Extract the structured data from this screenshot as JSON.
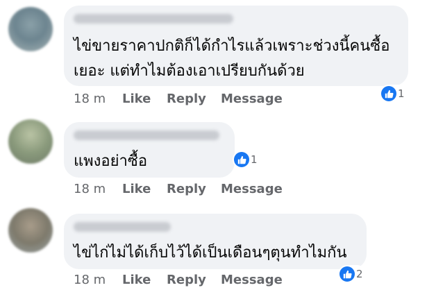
{
  "comments": [
    {
      "text_lines": [
        "ไข่ขายราคาปกติก็ได้กำไรแล้วเพราะช่วงนี้คนซื้อ",
        "เยอะ แต่ทำไมต้องเอาเปรียบกันด้วย"
      ],
      "time": "18 m",
      "like_label": "Like",
      "reply_label": "Reply",
      "message_label": "Message",
      "reaction_count": "1"
    },
    {
      "text_lines": [
        "แพงอย่าซื้อ"
      ],
      "time": "18 m",
      "like_label": "Like",
      "reply_label": "Reply",
      "message_label": "Message",
      "reaction_count": "1"
    },
    {
      "text_lines": [
        "ไข่ไก่ไม่ได้เก็บไว้ได้เป็นเดือนๆตุนทำไมกัน"
      ],
      "time": "18 m",
      "like_label": "Like",
      "reply_label": "Reply",
      "message_label": "Message",
      "reaction_count": "2"
    }
  ],
  "colors": {
    "bubble_bg": "#f0f2f5",
    "like_blue": "#1877f2",
    "meta_gray": "#65676b"
  },
  "icons": {
    "reaction": "thumbs-up-icon"
  }
}
